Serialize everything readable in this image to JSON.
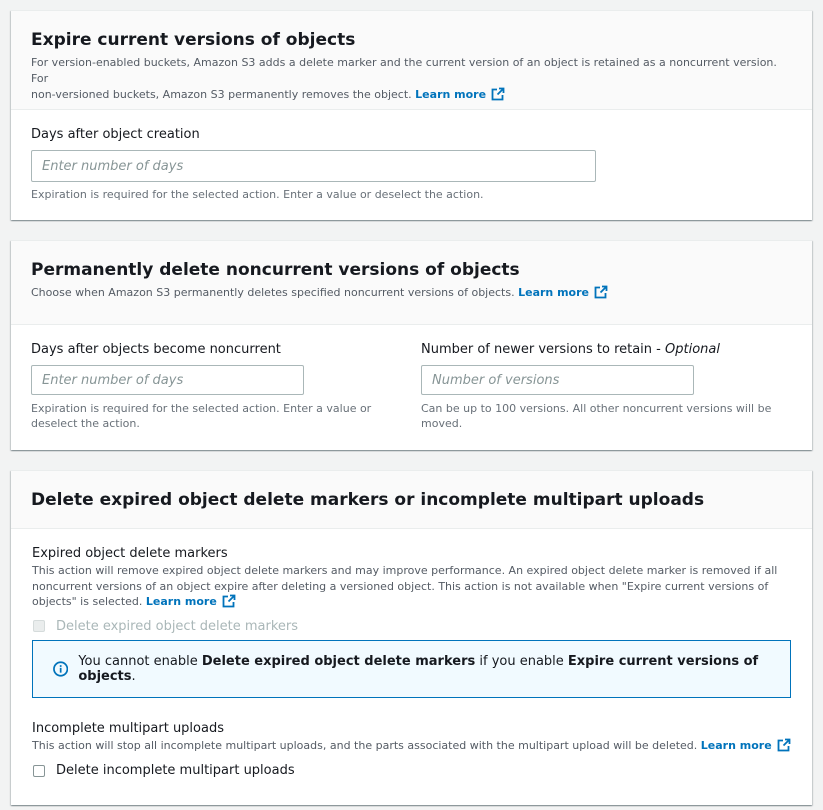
{
  "colors": {
    "link": "#0073bb",
    "info_border": "#0073bb",
    "info_bg": "#f1faff"
  },
  "icons": {
    "external": "external-link-icon",
    "info": "info-circle-icon"
  },
  "expire_current": {
    "title": "Expire current versions of objects",
    "desc_line1": "For version-enabled buckets, Amazon S3 adds a delete marker and the current version of an object is retained as a noncurrent version. For",
    "desc_line2": "non-versioned buckets, Amazon S3 permanently removes the object.",
    "learn_more": "Learn more",
    "field_label": "Days after object creation",
    "field_placeholder": "Enter number of days",
    "field_value": "",
    "hint": "Expiration is required for the selected action. Enter a value or deselect the action."
  },
  "delete_noncurrent": {
    "title": "Permanently delete noncurrent versions of objects",
    "desc": "Choose when Amazon S3 permanently deletes specified noncurrent versions of objects.",
    "learn_more": "Learn more",
    "days_label": "Days after objects become noncurrent",
    "days_placeholder": "Enter number of days",
    "days_value": "",
    "days_hint_line1": "Expiration is required for the selected action. Enter a value or",
    "days_hint_line2": "deselect the action.",
    "versions_label": "Number of newer versions to retain - ",
    "versions_label_optional": "Optional",
    "versions_placeholder": "Number of versions",
    "versions_value": "",
    "versions_hint_line1": "Can be up to 100 versions. All other noncurrent versions will be",
    "versions_hint_line2": "moved."
  },
  "delete_markers": {
    "title": "Delete expired object delete markers or incomplete multipart uploads",
    "markers_label": "Expired object delete markers",
    "markers_desc_line1": "This action will remove expired object delete markers and may improve performance. An expired object delete marker is removed if all",
    "markers_desc_line2": "noncurrent versions of an object expire after deleting a versioned object. This action is not available when \"Expire current versions of",
    "markers_desc_line3": "objects\" is selected.",
    "markers_learn_more": "Learn more",
    "markers_checkbox": "Delete expired object delete markers",
    "markers_checked": false,
    "info_pre": "You cannot enable ",
    "info_bold1": "Delete expired object delete markers",
    "info_mid": " if you enable ",
    "info_bold2": "Expire current versions of objects",
    "info_post": ".",
    "multipart_label": "Incomplete multipart uploads",
    "multipart_desc": "This action will stop all incomplete multipart uploads, and the parts associated with the multipart upload will be deleted.",
    "multipart_learn_more": "Learn more",
    "multipart_checkbox": "Delete incomplete multipart uploads",
    "multipart_checked": false
  }
}
